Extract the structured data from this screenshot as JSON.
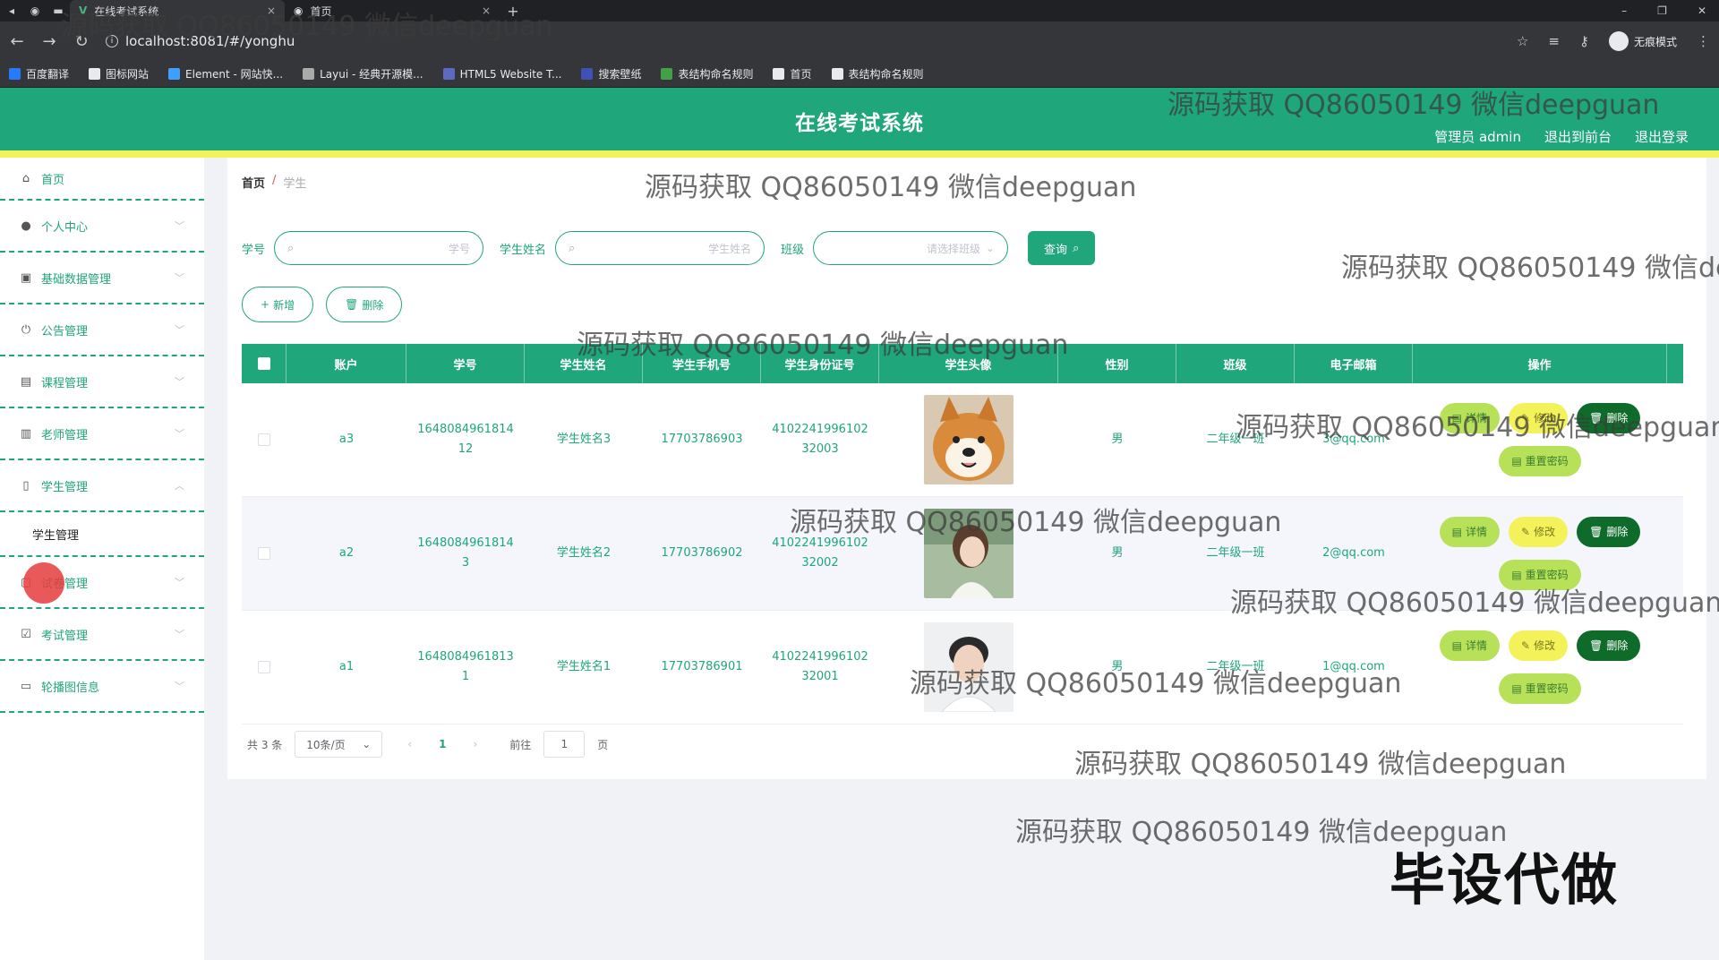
{
  "browser": {
    "tabs": [
      {
        "label": "在线考试系统",
        "active": true
      },
      {
        "label": "首页",
        "active": false
      }
    ],
    "url": "localhost:8081/#/yonghu",
    "profile_label": "无痕模式",
    "bookmarks": [
      {
        "label": "百度翻译",
        "color": "#2979ff"
      },
      {
        "label": "图标网站",
        "color": "#e8eaed"
      },
      {
        "label": "Element - 网站快...",
        "color": "#409eff"
      },
      {
        "label": "Layui - 经典开源模...",
        "color": "#aaaaaa"
      },
      {
        "label": "HTML5 Website T...",
        "color": "#5c6bc0"
      },
      {
        "label": "搜索壁纸",
        "color": "#3f51b5"
      },
      {
        "label": "表结构命名规则",
        "color": "#43a047"
      },
      {
        "label": "首页",
        "color": "#e8eaed"
      },
      {
        "label": "表结构命名规则",
        "color": "#e8eaed"
      }
    ]
  },
  "header": {
    "title": "在线考试系统",
    "user": "管理员 admin",
    "back_label": "退出到前台",
    "logout_label": "退出登录",
    "accent": "#1fa67a",
    "stripe": "#f4f25a"
  },
  "sidebar": {
    "items": [
      {
        "label": "首页",
        "icon": "home-icon"
      },
      {
        "label": "个人中心",
        "icon": "user-icon"
      },
      {
        "label": "基础数据管理",
        "icon": "briefcase-icon"
      },
      {
        "label": "公告管理",
        "icon": "power-icon"
      },
      {
        "label": "课程管理",
        "icon": "clipboard-icon"
      },
      {
        "label": "老师管理",
        "icon": "chart-icon"
      },
      {
        "label": "学生管理",
        "icon": "phone-icon"
      },
      {
        "label": "试卷管理",
        "icon": "file-icon"
      },
      {
        "label": "考试管理",
        "icon": "checkbox-icon"
      },
      {
        "label": "轮播图信息",
        "icon": "monitor-icon"
      }
    ],
    "submenu_label": "学生管理"
  },
  "breadcrumb": {
    "home": "首页",
    "sep": "/",
    "current": "学生"
  },
  "search": {
    "label_id": "学号",
    "placeholder_id": "学号",
    "label_name": "学生姓名",
    "placeholder_name": "学生姓名",
    "label_class": "班级",
    "placeholder_class": "请选择班级",
    "query_label": "查询"
  },
  "actions": {
    "add_label": "新增",
    "delete_label": "删除"
  },
  "table": {
    "headers": [
      "账户",
      "学号",
      "学生姓名",
      "学生手机号",
      "学生身份证号",
      "学生头像",
      "性别",
      "班级",
      "电子邮箱",
      "操作"
    ],
    "rows": [
      {
        "account": "a3",
        "student_no_1": "1648084961814",
        "student_no_2": "12",
        "name": "学生姓名3",
        "phone": "17703786903",
        "id_1": "4102241996102",
        "id_2": "32003",
        "avatar": "dog",
        "gender": "男",
        "class": "二年级一班",
        "email": "3@qq.com"
      },
      {
        "account": "a2",
        "student_no_1": "1648084961814",
        "student_no_2": "3",
        "name": "学生姓名2",
        "phone": "17703786902",
        "id_1": "4102241996102",
        "id_2": "32002",
        "avatar": "girl",
        "gender": "男",
        "class": "二年级一班",
        "email": "2@qq.com"
      },
      {
        "account": "a1",
        "student_no_1": "1648084961813",
        "student_no_2": "1",
        "name": "学生姓名1",
        "phone": "17703786901",
        "id_1": "4102241996102",
        "id_2": "32001",
        "avatar": "boy",
        "gender": "男",
        "class": "二年级一班",
        "email": "1@qq.com"
      }
    ],
    "ops": {
      "detail": "详情",
      "edit": "修改",
      "delete": "删除",
      "reset": "重置密码"
    }
  },
  "pager": {
    "total": "共 3 条",
    "size": "10条/页",
    "page": "1",
    "goto": "前往",
    "goto_value": "1",
    "page_suffix": "页"
  },
  "watermark": "源码获取 QQ86050149 微信deepguan",
  "corner_text": "毕设代做"
}
